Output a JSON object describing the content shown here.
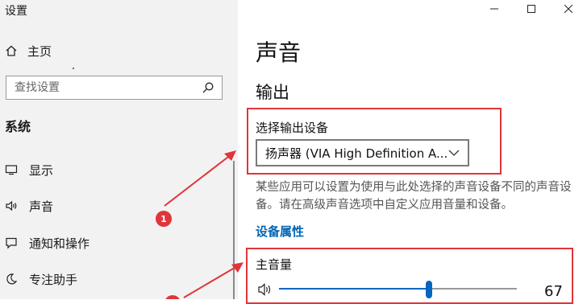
{
  "window": {
    "title": "设置"
  },
  "sidebar": {
    "home_label": "主页",
    "search_placeholder": "查找设置",
    "section_title": "系统",
    "items": [
      {
        "label": "显示",
        "icon": "monitor-icon"
      },
      {
        "label": "声音",
        "icon": "speaker-icon"
      },
      {
        "label": "通知和操作",
        "icon": "notification-icon"
      },
      {
        "label": "专注助手",
        "icon": "moon-icon"
      }
    ]
  },
  "main": {
    "title": "声音",
    "output_heading": "输出",
    "choose_device_label": "选择输出设备",
    "device_value": "扬声器 (VIA High Definition A...",
    "description": "某些应用可以设置为使用与此处选择的声音设备不同的声音设备。请在高级声音选项中自定义应用音量和设备。",
    "device_properties_link": "设备属性",
    "master_volume_label": "主音量",
    "volume_value": "67",
    "volume_level": 0.63
  },
  "annotations": {
    "marker_1": "1",
    "accent_color": "#e0353a"
  }
}
